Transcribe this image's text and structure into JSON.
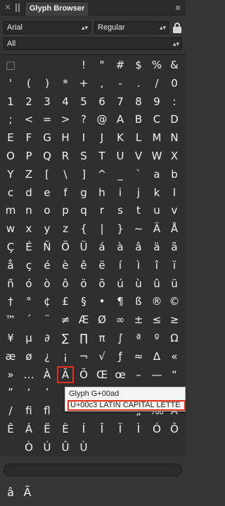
{
  "titlebar": {
    "tab_label": "Glyph Browser"
  },
  "font_family": {
    "value": "Arial"
  },
  "font_style": {
    "value": "Regular"
  },
  "subset": {
    "value": "All"
  },
  "glyph_rows": [
    [
      "□",
      "",
      "",
      "",
      "!",
      "\"",
      "#",
      "$",
      "%",
      "&"
    ],
    [
      "'",
      "(",
      ")",
      "*",
      "+",
      ",",
      "-",
      ".",
      "/",
      "0"
    ],
    [
      "1",
      "2",
      "3",
      "4",
      "5",
      "6",
      "7",
      "8",
      "9",
      ":"
    ],
    [
      ";",
      "<",
      "=",
      ">",
      "?",
      "@",
      "A",
      "B",
      "C",
      "D"
    ],
    [
      "E",
      "F",
      "G",
      "H",
      "I",
      "J",
      "K",
      "L",
      "M",
      "N"
    ],
    [
      "O",
      "P",
      "Q",
      "R",
      "S",
      "T",
      "U",
      "V",
      "W",
      "X"
    ],
    [
      "Y",
      "Z",
      "[",
      "\\",
      "]",
      "^",
      "_",
      "`",
      "a",
      "b"
    ],
    [
      "c",
      "d",
      "e",
      "f",
      "g",
      "h",
      "i",
      "j",
      "k",
      "l"
    ],
    [
      "m",
      "n",
      "o",
      "p",
      "q",
      "r",
      "s",
      "t",
      "u",
      "v"
    ],
    [
      "w",
      "x",
      "y",
      "z",
      "{",
      "|",
      "}",
      "~",
      "Ä",
      "Å"
    ],
    [
      "Ç",
      "É",
      "Ñ",
      "Ö",
      "Ü",
      "á",
      "à",
      "â",
      "ä",
      "ã"
    ],
    [
      "å",
      "ç",
      "é",
      "è",
      "ê",
      "ë",
      "í",
      "ì",
      "î",
      "ï"
    ],
    [
      "ñ",
      "ó",
      "ò",
      "ô",
      "ö",
      "õ",
      "ú",
      "ù",
      "û",
      "ü"
    ],
    [
      "†",
      "°",
      "¢",
      "£",
      "§",
      "•",
      "¶",
      "ß",
      "®",
      "©"
    ],
    [
      "™",
      "´",
      "¨",
      "≠",
      "Æ",
      "Ø",
      "∞",
      "±",
      "≤",
      "≥"
    ],
    [
      "¥",
      "µ",
      "∂",
      "∑",
      "∏",
      "π",
      "∫",
      "ª",
      "º",
      "Ω"
    ],
    [
      "æ",
      "ø",
      "¿",
      "¡",
      "¬",
      "√",
      "ƒ",
      "≈",
      "∆",
      "«"
    ],
    [
      "»",
      "…",
      "À",
      "Ã",
      "Õ",
      "Œ",
      "œ",
      "–",
      "—",
      "“"
    ],
    [
      "”",
      "‘",
      "’",
      "",
      "",
      "",
      "",
      "",
      "",
      ""
    ],
    [
      "/",
      "fi",
      "fl",
      "",
      "",
      "",
      "",
      "„",
      "‰",
      "Â"
    ],
    [
      "Ê",
      "Á",
      "Ë",
      "È",
      "Í",
      "Î",
      "Ï",
      "Ì",
      "Ó",
      "Ô"
    ],
    [
      "",
      "Ò",
      "Ú",
      "Û",
      "Ù",
      "",
      "",
      "",
      "",
      ""
    ]
  ],
  "selected_glyph": "Ã",
  "tooltip": {
    "line1": "Glyph G+00ad",
    "line2": "U+00c3 LATIN CAPITAL LETTE"
  },
  "search": {
    "placeholder": ""
  },
  "recent_glyphs": [
    "â",
    "Ã"
  ]
}
